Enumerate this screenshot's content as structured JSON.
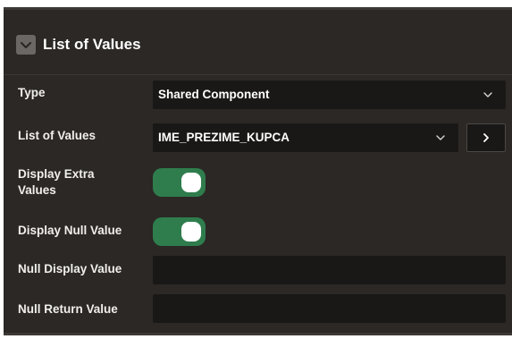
{
  "section": {
    "title": "List of Values",
    "collapse_icon": "chevron-down-icon"
  },
  "fields": {
    "type": {
      "label": "Type",
      "value": "Shared Component"
    },
    "list_of_values": {
      "label": "List of Values",
      "value": "IME_PREZIME_KUPCA",
      "open_icon": "chevron-right-icon"
    },
    "display_extra_values": {
      "label": "Display Extra Values",
      "enabled": true
    },
    "display_null_value": {
      "label": "Display Null Value",
      "enabled": true
    },
    "null_display_value": {
      "label": "Null Display Value",
      "value": ""
    },
    "null_return_value": {
      "label": "Null Return Value",
      "value": ""
    }
  },
  "colors": {
    "panel_bg": "#2b2825",
    "field_bg": "#1a1816",
    "toggle_on": "#2f7d4d",
    "text": "#ffffff"
  }
}
